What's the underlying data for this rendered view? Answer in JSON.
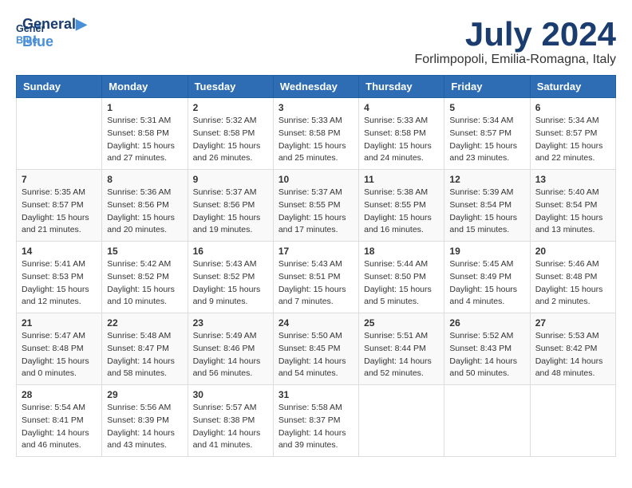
{
  "header": {
    "logo_general": "General",
    "logo_blue": "Blue",
    "month": "July 2024",
    "location": "Forlimpopoli, Emilia-Romagna, Italy"
  },
  "days_of_week": [
    "Sunday",
    "Monday",
    "Tuesday",
    "Wednesday",
    "Thursday",
    "Friday",
    "Saturday"
  ],
  "weeks": [
    [
      {
        "day": "",
        "sunrise": "",
        "sunset": "",
        "daylight": ""
      },
      {
        "day": "1",
        "sunrise": "Sunrise: 5:31 AM",
        "sunset": "Sunset: 8:58 PM",
        "daylight": "Daylight: 15 hours and 27 minutes."
      },
      {
        "day": "2",
        "sunrise": "Sunrise: 5:32 AM",
        "sunset": "Sunset: 8:58 PM",
        "daylight": "Daylight: 15 hours and 26 minutes."
      },
      {
        "day": "3",
        "sunrise": "Sunrise: 5:33 AM",
        "sunset": "Sunset: 8:58 PM",
        "daylight": "Daylight: 15 hours and 25 minutes."
      },
      {
        "day": "4",
        "sunrise": "Sunrise: 5:33 AM",
        "sunset": "Sunset: 8:58 PM",
        "daylight": "Daylight: 15 hours and 24 minutes."
      },
      {
        "day": "5",
        "sunrise": "Sunrise: 5:34 AM",
        "sunset": "Sunset: 8:57 PM",
        "daylight": "Daylight: 15 hours and 23 minutes."
      },
      {
        "day": "6",
        "sunrise": "Sunrise: 5:34 AM",
        "sunset": "Sunset: 8:57 PM",
        "daylight": "Daylight: 15 hours and 22 minutes."
      }
    ],
    [
      {
        "day": "7",
        "sunrise": "Sunrise: 5:35 AM",
        "sunset": "Sunset: 8:57 PM",
        "daylight": "Daylight: 15 hours and 21 minutes."
      },
      {
        "day": "8",
        "sunrise": "Sunrise: 5:36 AM",
        "sunset": "Sunset: 8:56 PM",
        "daylight": "Daylight: 15 hours and 20 minutes."
      },
      {
        "day": "9",
        "sunrise": "Sunrise: 5:37 AM",
        "sunset": "Sunset: 8:56 PM",
        "daylight": "Daylight: 15 hours and 19 minutes."
      },
      {
        "day": "10",
        "sunrise": "Sunrise: 5:37 AM",
        "sunset": "Sunset: 8:55 PM",
        "daylight": "Daylight: 15 hours and 17 minutes."
      },
      {
        "day": "11",
        "sunrise": "Sunrise: 5:38 AM",
        "sunset": "Sunset: 8:55 PM",
        "daylight": "Daylight: 15 hours and 16 minutes."
      },
      {
        "day": "12",
        "sunrise": "Sunrise: 5:39 AM",
        "sunset": "Sunset: 8:54 PM",
        "daylight": "Daylight: 15 hours and 15 minutes."
      },
      {
        "day": "13",
        "sunrise": "Sunrise: 5:40 AM",
        "sunset": "Sunset: 8:54 PM",
        "daylight": "Daylight: 15 hours and 13 minutes."
      }
    ],
    [
      {
        "day": "14",
        "sunrise": "Sunrise: 5:41 AM",
        "sunset": "Sunset: 8:53 PM",
        "daylight": "Daylight: 15 hours and 12 minutes."
      },
      {
        "day": "15",
        "sunrise": "Sunrise: 5:42 AM",
        "sunset": "Sunset: 8:52 PM",
        "daylight": "Daylight: 15 hours and 10 minutes."
      },
      {
        "day": "16",
        "sunrise": "Sunrise: 5:43 AM",
        "sunset": "Sunset: 8:52 PM",
        "daylight": "Daylight: 15 hours and 9 minutes."
      },
      {
        "day": "17",
        "sunrise": "Sunrise: 5:43 AM",
        "sunset": "Sunset: 8:51 PM",
        "daylight": "Daylight: 15 hours and 7 minutes."
      },
      {
        "day": "18",
        "sunrise": "Sunrise: 5:44 AM",
        "sunset": "Sunset: 8:50 PM",
        "daylight": "Daylight: 15 hours and 5 minutes."
      },
      {
        "day": "19",
        "sunrise": "Sunrise: 5:45 AM",
        "sunset": "Sunset: 8:49 PM",
        "daylight": "Daylight: 15 hours and 4 minutes."
      },
      {
        "day": "20",
        "sunrise": "Sunrise: 5:46 AM",
        "sunset": "Sunset: 8:48 PM",
        "daylight": "Daylight: 15 hours and 2 minutes."
      }
    ],
    [
      {
        "day": "21",
        "sunrise": "Sunrise: 5:47 AM",
        "sunset": "Sunset: 8:48 PM",
        "daylight": "Daylight: 15 hours and 0 minutes."
      },
      {
        "day": "22",
        "sunrise": "Sunrise: 5:48 AM",
        "sunset": "Sunset: 8:47 PM",
        "daylight": "Daylight: 14 hours and 58 minutes."
      },
      {
        "day": "23",
        "sunrise": "Sunrise: 5:49 AM",
        "sunset": "Sunset: 8:46 PM",
        "daylight": "Daylight: 14 hours and 56 minutes."
      },
      {
        "day": "24",
        "sunrise": "Sunrise: 5:50 AM",
        "sunset": "Sunset: 8:45 PM",
        "daylight": "Daylight: 14 hours and 54 minutes."
      },
      {
        "day": "25",
        "sunrise": "Sunrise: 5:51 AM",
        "sunset": "Sunset: 8:44 PM",
        "daylight": "Daylight: 14 hours and 52 minutes."
      },
      {
        "day": "26",
        "sunrise": "Sunrise: 5:52 AM",
        "sunset": "Sunset: 8:43 PM",
        "daylight": "Daylight: 14 hours and 50 minutes."
      },
      {
        "day": "27",
        "sunrise": "Sunrise: 5:53 AM",
        "sunset": "Sunset: 8:42 PM",
        "daylight": "Daylight: 14 hours and 48 minutes."
      }
    ],
    [
      {
        "day": "28",
        "sunrise": "Sunrise: 5:54 AM",
        "sunset": "Sunset: 8:41 PM",
        "daylight": "Daylight: 14 hours and 46 minutes."
      },
      {
        "day": "29",
        "sunrise": "Sunrise: 5:56 AM",
        "sunset": "Sunset: 8:39 PM",
        "daylight": "Daylight: 14 hours and 43 minutes."
      },
      {
        "day": "30",
        "sunrise": "Sunrise: 5:57 AM",
        "sunset": "Sunset: 8:38 PM",
        "daylight": "Daylight: 14 hours and 41 minutes."
      },
      {
        "day": "31",
        "sunrise": "Sunrise: 5:58 AM",
        "sunset": "Sunset: 8:37 PM",
        "daylight": "Daylight: 14 hours and 39 minutes."
      },
      {
        "day": "",
        "sunrise": "",
        "sunset": "",
        "daylight": ""
      },
      {
        "day": "",
        "sunrise": "",
        "sunset": "",
        "daylight": ""
      },
      {
        "day": "",
        "sunrise": "",
        "sunset": "",
        "daylight": ""
      }
    ]
  ]
}
